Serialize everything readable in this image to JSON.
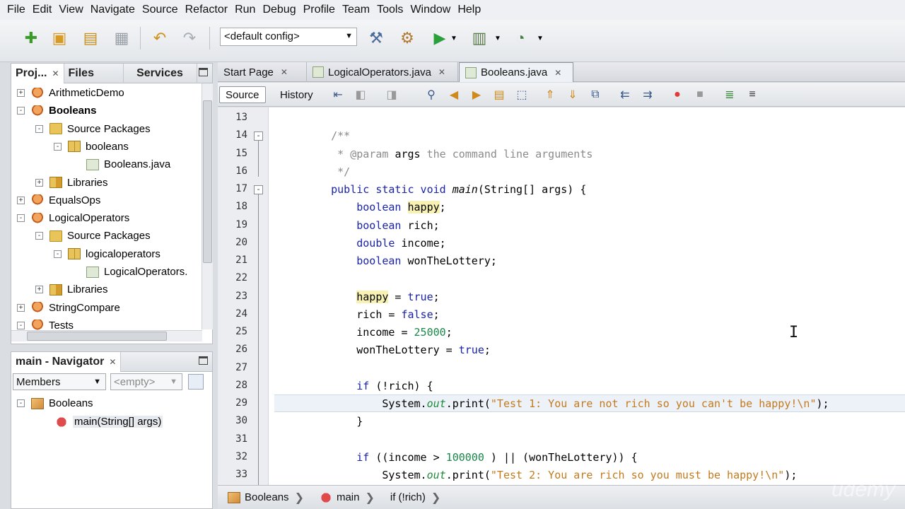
{
  "menu": [
    "File",
    "Edit",
    "View",
    "Navigate",
    "Source",
    "Refactor",
    "Run",
    "Debug",
    "Profile",
    "Team",
    "Tools",
    "Window",
    "Help"
  ],
  "toolbar": {
    "config": "<default config>"
  },
  "projects_panel": {
    "tabs": [
      "Proj...",
      "Files",
      "Services"
    ],
    "tree": [
      {
        "label": "ArithmeticDemo",
        "level": 0,
        "icon": "project-icon",
        "expander": "+"
      },
      {
        "label": "Booleans",
        "level": 0,
        "icon": "project-icon",
        "expander": "-",
        "bold": true
      },
      {
        "label": "Source Packages",
        "level": 1,
        "icon": "source-packages-icon",
        "expander": "-"
      },
      {
        "label": "booleans",
        "level": 2,
        "icon": "package-icon",
        "expander": "-"
      },
      {
        "label": "Booleans.java",
        "level": 3,
        "icon": "java-file-icon",
        "expander": ""
      },
      {
        "label": "Libraries",
        "level": 1,
        "icon": "libraries-icon",
        "expander": "+"
      },
      {
        "label": "EqualsOps",
        "level": 0,
        "icon": "project-icon",
        "expander": "+"
      },
      {
        "label": "LogicalOperators",
        "level": 0,
        "icon": "project-icon",
        "expander": "-"
      },
      {
        "label": "Source Packages",
        "level": 1,
        "icon": "source-packages-icon",
        "expander": "-"
      },
      {
        "label": "logicaloperators",
        "level": 2,
        "icon": "package-icon",
        "expander": "-"
      },
      {
        "label": "LogicalOperators.",
        "level": 3,
        "icon": "java-file-icon",
        "expander": ""
      },
      {
        "label": "Libraries",
        "level": 1,
        "icon": "libraries-icon",
        "expander": "+"
      },
      {
        "label": "StringCompare",
        "level": 0,
        "icon": "project-icon",
        "expander": "+"
      },
      {
        "label": "Tests",
        "level": 0,
        "icon": "project-icon",
        "expander": "-"
      }
    ]
  },
  "navigator": {
    "title": "main - Navigator",
    "filter": "Members",
    "scope": "<empty>",
    "tree": [
      {
        "label": "Booleans",
        "level": 0
      },
      {
        "label": "main(String[] args)",
        "level": 1
      }
    ]
  },
  "editor": {
    "tabs": [
      "Start Page",
      "LogicalOperators.java",
      "Booleans.java"
    ],
    "active_tab": "Booleans.java",
    "source_label": "Source",
    "history_label": "History",
    "first_line_number": 13,
    "current_line": 29,
    "lines": [
      [],
      [
        {
          "t": "    /**",
          "c": "cm"
        }
      ],
      [
        {
          "t": "     * @param ",
          "c": "cm"
        },
        {
          "t": "args",
          "c": ""
        },
        {
          "t": " the command line arguments",
          "c": "cm"
        }
      ],
      [
        {
          "t": "     */",
          "c": "cm"
        }
      ],
      [
        {
          "t": "    ",
          "c": ""
        },
        {
          "t": "public static void ",
          "c": "kw"
        },
        {
          "t": "main",
          "c": "meth"
        },
        {
          "t": "(String[] args) {",
          "c": ""
        }
      ],
      [
        {
          "t": "        ",
          "c": ""
        },
        {
          "t": "boolean ",
          "c": "kw"
        },
        {
          "t": "happy",
          "c": "hl"
        },
        {
          "t": ";",
          "c": ""
        }
      ],
      [
        {
          "t": "        ",
          "c": ""
        },
        {
          "t": "boolean ",
          "c": "kw"
        },
        {
          "t": "rich;",
          "c": ""
        }
      ],
      [
        {
          "t": "        ",
          "c": ""
        },
        {
          "t": "double ",
          "c": "kw"
        },
        {
          "t": "income;",
          "c": ""
        }
      ],
      [
        {
          "t": "        ",
          "c": ""
        },
        {
          "t": "boolean ",
          "c": "kw"
        },
        {
          "t": "wonTheLottery;",
          "c": ""
        }
      ],
      [],
      [
        {
          "t": "        ",
          "c": ""
        },
        {
          "t": "happy",
          "c": "hl"
        },
        {
          "t": " = ",
          "c": ""
        },
        {
          "t": "true",
          "c": "kw"
        },
        {
          "t": ";",
          "c": ""
        }
      ],
      [
        {
          "t": "        rich = ",
          "c": ""
        },
        {
          "t": "false",
          "c": "kw"
        },
        {
          "t": ";",
          "c": ""
        }
      ],
      [
        {
          "t": "        income = ",
          "c": ""
        },
        {
          "t": "25000",
          "c": "num"
        },
        {
          "t": ";",
          "c": ""
        }
      ],
      [
        {
          "t": "        wonTheLottery = ",
          "c": ""
        },
        {
          "t": "true",
          "c": "kw"
        },
        {
          "t": ";",
          "c": ""
        }
      ],
      [],
      [
        {
          "t": "        ",
          "c": ""
        },
        {
          "t": "if",
          "c": "kw"
        },
        {
          "t": " (!rich) {",
          "c": ""
        }
      ],
      [
        {
          "t": "            System.",
          "c": ""
        },
        {
          "t": "out",
          "c": "fld"
        },
        {
          "t": ".print(",
          "c": ""
        },
        {
          "t": "\"Test 1: You are not rich so you can't be happy!\\n\"",
          "c": "str"
        },
        {
          "t": ");",
          "c": ""
        }
      ],
      [
        {
          "t": "        }",
          "c": ""
        }
      ],
      [],
      [
        {
          "t": "        ",
          "c": ""
        },
        {
          "t": "if",
          "c": "kw"
        },
        {
          "t": " ((income > ",
          "c": ""
        },
        {
          "t": "100000",
          "c": "num"
        },
        {
          "t": " ) || (wonTheLottery)) {",
          "c": ""
        }
      ],
      [
        {
          "t": "            System.",
          "c": ""
        },
        {
          "t": "out",
          "c": "fld"
        },
        {
          "t": ".print(",
          "c": ""
        },
        {
          "t": "\"Test 2: You are rich so you must be happy!\\n\"",
          "c": "str"
        },
        {
          "t": ");",
          "c": ""
        }
      ]
    ]
  },
  "breadcrumb": [
    "Booleans",
    "main",
    "if (!rich)"
  ],
  "watermark": "udemy",
  "colors": {
    "keyword": "#1a23a8",
    "comment": "#8a8a8a",
    "string": "#c47a1c",
    "number": "#19884a",
    "highlight": "#f7f2b3"
  }
}
